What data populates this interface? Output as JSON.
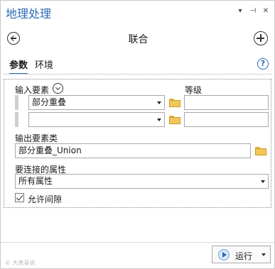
{
  "pane": {
    "title": "地理处理",
    "titlebar_icons": [
      "dropdown-icon",
      "pin-icon",
      "close-icon"
    ]
  },
  "tool": {
    "title": "联合"
  },
  "tabs": [
    {
      "label": "参数",
      "active": true
    },
    {
      "label": "环境",
      "active": false
    }
  ],
  "params": {
    "input_features_label": "输入要素",
    "rank_label": "等级",
    "input_rows": [
      {
        "value": "部分重叠",
        "rank": ""
      },
      {
        "value": "",
        "rank": ""
      }
    ],
    "output_label": "输出要素类",
    "output_value": "部分重叠_Union",
    "attributes_label": "要连接的属性",
    "attributes_value": "所有属性",
    "gaps_label": "允许间隙",
    "gaps_checked": true
  },
  "footer": {
    "run_label": "运行"
  },
  "watermark": "© 大表哥说"
}
